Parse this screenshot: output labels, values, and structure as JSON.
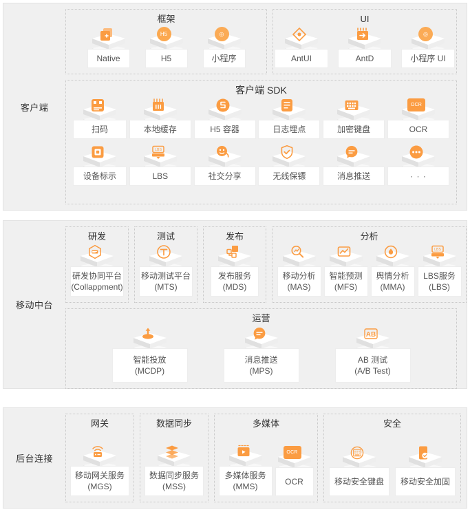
{
  "accent": "#fb9c42",
  "panel_bg": "#f0f0f0",
  "sections": [
    {
      "label": "客户端",
      "rows": [
        {
          "groups": [
            {
              "title": "框架",
              "nodes": [
                {
                  "label": "Native",
                  "icon": "copy-plus-icon"
                },
                {
                  "label": "H5",
                  "icon": "h5-circle-icon"
                },
                {
                  "label": "小程序",
                  "icon": "mini-program-circle-icon"
                }
              ]
            },
            {
              "title": "UI",
              "nodes": [
                {
                  "label": "AntUI",
                  "icon": "diamond-icon"
                },
                {
                  "label": "AntD",
                  "icon": "calendar-arrow-icon"
                },
                {
                  "label": "小程序 UI",
                  "icon": "mini-program-circle-icon"
                }
              ]
            }
          ]
        },
        {
          "groups": [
            {
              "title": "客户端 SDK",
              "nodes": [
                {
                  "label": "扫码",
                  "icon": "scan-code-icon"
                },
                {
                  "label": "本地缓存",
                  "icon": "cache-icon"
                },
                {
                  "label": "H5 容器",
                  "icon": "h5-container-icon"
                },
                {
                  "label": "日志埋点",
                  "icon": "log-tracking-icon"
                },
                {
                  "label": "加密键盘",
                  "icon": "keyboard-icon"
                },
                {
                  "label": "OCR",
                  "icon": "ocr-icon"
                },
                {
                  "label": "设备标示",
                  "icon": "device-id-icon"
                },
                {
                  "label": "LBS",
                  "icon": "lbs-icon"
                },
                {
                  "label": "社交分享",
                  "icon": "share-icon"
                },
                {
                  "label": "无线保镖",
                  "icon": "shield-check-icon"
                },
                {
                  "label": "消息推送",
                  "icon": "message-push-icon"
                },
                {
                  "label": "· · ·",
                  "icon": "ellipsis-icon"
                }
              ]
            }
          ]
        }
      ]
    },
    {
      "label": "移动中台",
      "rows": [
        {
          "groups": [
            {
              "title": "研发",
              "nodes": [
                {
                  "label": "研发协同平台",
                  "label2": "(Collappment)",
                  "icon": "hexagon-dev-icon"
                }
              ]
            },
            {
              "title": "测试",
              "nodes": [
                {
                  "label": "移动测试平台",
                  "label2": "(MTS)",
                  "icon": "test-circle-icon"
                }
              ]
            },
            {
              "title": "发布",
              "nodes": [
                {
                  "label": "发布服务",
                  "label2": "(MDS)",
                  "icon": "release-icon"
                }
              ]
            },
            {
              "title": "分析",
              "nodes": [
                {
                  "label": "移动分析",
                  "label2": "(MAS)",
                  "icon": "magnifier-icon"
                },
                {
                  "label": "智能预测",
                  "label2": "(MFS)",
                  "icon": "trend-chart-icon"
                },
                {
                  "label": "舆情分析",
                  "label2": "(MMA)",
                  "icon": "sentiment-icon"
                },
                {
                  "label": "LBS服务",
                  "label2": "(LBS)",
                  "icon": "lbs-icon"
                }
              ]
            }
          ]
        },
        {
          "groups": [
            {
              "title": "运营",
              "nodes": [
                {
                  "label": "智能投放",
                  "label2": "(MCDP)",
                  "icon": "delivery-icon"
                },
                {
                  "label": "消息推送",
                  "label2": "(MPS)",
                  "icon": "message-push-icon"
                },
                {
                  "label": "AB 测试",
                  "label2": "(A/B Test)",
                  "icon": "ab-test-icon"
                }
              ]
            }
          ]
        }
      ]
    },
    {
      "label": "后台连接",
      "rows": [
        {
          "groups": [
            {
              "title": "网关",
              "nodes": [
                {
                  "label": "移动网关服务",
                  "label2": "(MGS)",
                  "icon": "gateway-signal-icon"
                }
              ]
            },
            {
              "title": "数据同步",
              "nodes": [
                {
                  "label": "数据同步服务",
                  "label2": "(MSS)",
                  "icon": "layers-sync-icon"
                }
              ]
            },
            {
              "title": "多媒体",
              "nodes": [
                {
                  "label": "多媒体服务",
                  "label2": "(MMS)",
                  "icon": "media-play-icon"
                },
                {
                  "label": "OCR",
                  "icon": "ocr-icon"
                }
              ]
            },
            {
              "title": "安全",
              "nodes": [
                {
                  "label": "移动安全键盘",
                  "icon": "secure-keypad-icon"
                },
                {
                  "label": "移动安全加固",
                  "icon": "phone-lock-icon"
                }
              ]
            }
          ]
        }
      ]
    }
  ]
}
